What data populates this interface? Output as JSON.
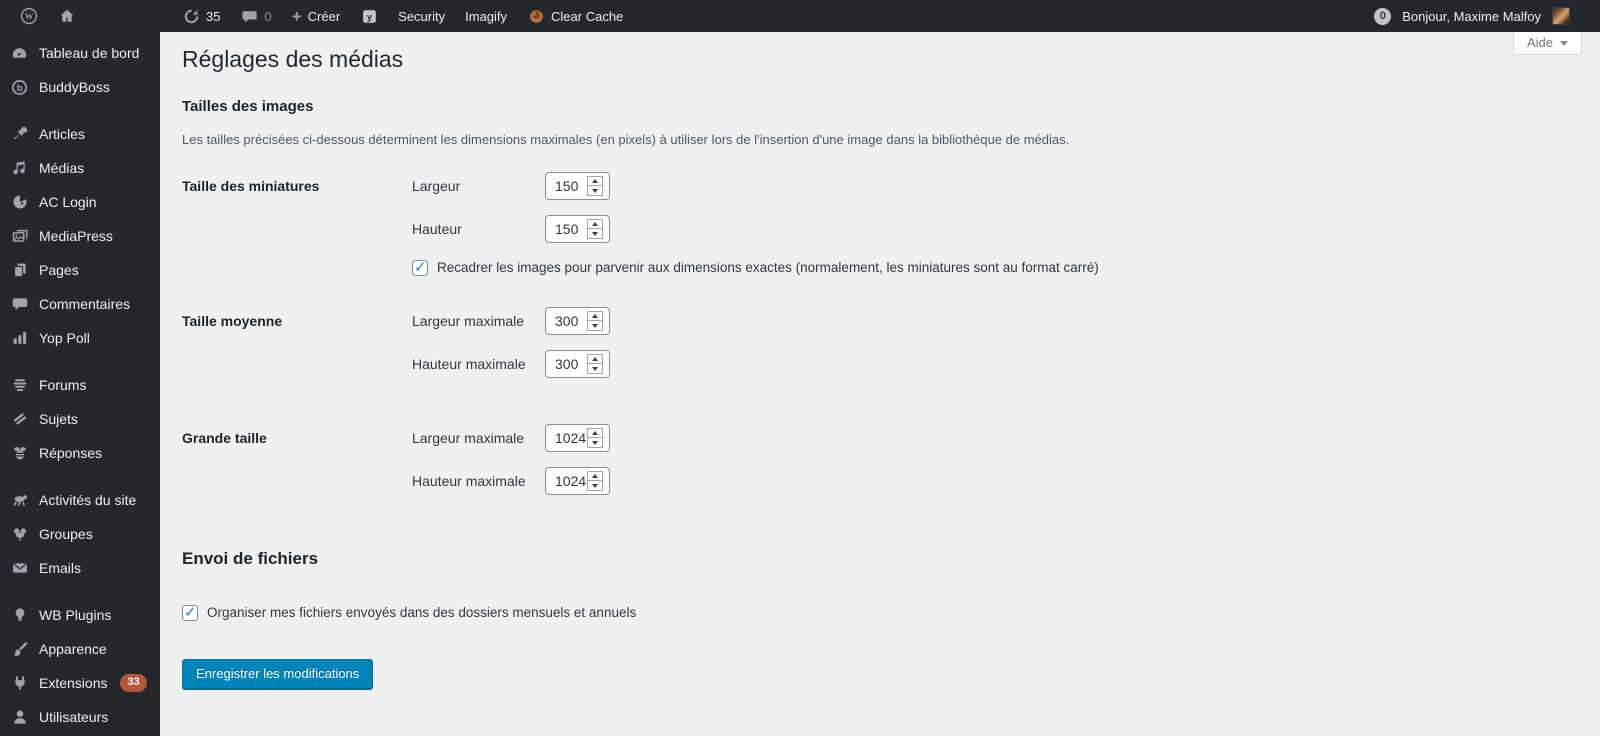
{
  "admin_bar": {
    "updates_count": "35",
    "comments_count": "0",
    "new_label": "Créer",
    "security_label": "Security",
    "imagify_label": "Imagify",
    "clear_cache_label": "Clear Cache",
    "notification_count": "0",
    "greeting": "Bonjour, Maxime Malfoy"
  },
  "help_tab": {
    "label": "Aide"
  },
  "sidebar": {
    "items": [
      {
        "label": "Tableau de bord",
        "icon": "dashboard-icon"
      },
      {
        "label": "BuddyBoss",
        "icon": "buddyboss-icon"
      },
      {
        "label": "Articles",
        "icon": "pin-icon"
      },
      {
        "label": "Médias",
        "icon": "media-icon"
      },
      {
        "label": "AC Login",
        "icon": "ac-login-icon"
      },
      {
        "label": "MediaPress",
        "icon": "mediapress-icon"
      },
      {
        "label": "Pages",
        "icon": "pages-icon"
      },
      {
        "label": "Commentaires",
        "icon": "comment-icon"
      },
      {
        "label": "Yop Poll",
        "icon": "poll-icon"
      },
      {
        "label": "Forums",
        "icon": "forums-icon"
      },
      {
        "label": "Sujets",
        "icon": "topics-icon"
      },
      {
        "label": "Réponses",
        "icon": "bee-icon"
      },
      {
        "label": "Activités du site",
        "icon": "activity-icon"
      },
      {
        "label": "Groupes",
        "icon": "groups-icon"
      },
      {
        "label": "Emails",
        "icon": "email-icon"
      },
      {
        "label": "WB Plugins",
        "icon": "bulb-icon"
      },
      {
        "label": "Apparence",
        "icon": "brush-icon"
      },
      {
        "label": "Extensions",
        "icon": "plug-icon",
        "badge": "33"
      },
      {
        "label": "Utilisateurs",
        "icon": "user-icon"
      }
    ]
  },
  "page": {
    "title": "Réglages des médias",
    "image_sizes": {
      "heading": "Tailles des images",
      "description": "Les tailles précisées ci-dessous déterminent les dimensions maximales (en pixels) à utiliser lors de l'insertion d'une image dans la bibliothèque de médias.",
      "thumbnail": {
        "label": "Taille des miniatures",
        "width_label": "Largeur",
        "width_value": "150",
        "height_label": "Hauteur",
        "height_value": "150",
        "crop_label": "Recadrer les images pour parvenir aux dimensions exactes (normalement, les miniatures sont au format carré)",
        "crop_checked": true
      },
      "medium": {
        "label": "Taille moyenne",
        "width_label": "Largeur maximale",
        "width_value": "300",
        "height_label": "Hauteur maximale",
        "height_value": "300"
      },
      "large": {
        "label": "Grande taille",
        "width_label": "Largeur maximale",
        "width_value": "1024",
        "height_label": "Hauteur maximale",
        "height_value": "1024"
      }
    },
    "uploads": {
      "heading": "Envoi de fichiers",
      "organize_label": "Organiser mes fichiers envoyés dans des dossiers mensuels et annuels",
      "organize_checked": true
    },
    "submit_label": "Enregistrer les modifications"
  },
  "colors": {
    "adminbar_bg": "#23282d",
    "content_bg": "#f0f0f1",
    "primary_button": "#0085ba",
    "checkbox_check": "#1e8cbe",
    "extensions_badge": "#b2573b"
  }
}
